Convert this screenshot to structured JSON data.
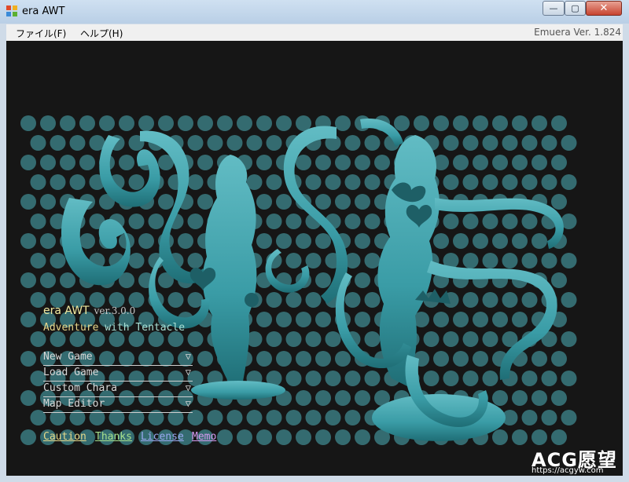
{
  "window": {
    "title": "era AWT",
    "minimize": "—",
    "maximize": "▢",
    "close": "✕"
  },
  "menubar": {
    "file": "ファイル(F)",
    "help": "ヘルプ(H)",
    "version": "Emuera Ver. 1.824"
  },
  "game": {
    "title": "era AWT",
    "version": "ver.3.0.0",
    "subtitle_part1": "Adventure",
    "subtitle_part2": " with Tentacle",
    "menu": [
      {
        "label": "New Game",
        "arrow": "▽"
      },
      {
        "label": "Load Game",
        "arrow": "▽"
      },
      {
        "label": "Custom Chara",
        "arrow": "▽"
      },
      {
        "label": "Map Editor",
        "arrow": "▽"
      }
    ],
    "links": [
      {
        "label": "Caution",
        "color": "#e6d98a"
      },
      {
        "label": "Thanks",
        "color": "#a6e08c"
      },
      {
        "label": "License",
        "color": "#9aa8f0"
      },
      {
        "label": "Memo",
        "color": "#d59af0"
      }
    ],
    "colors": {
      "accent": "#4fb3bb",
      "background": "#161616"
    }
  },
  "watermark": {
    "main": "ACG愿望",
    "url": "https://acgyw.com"
  }
}
